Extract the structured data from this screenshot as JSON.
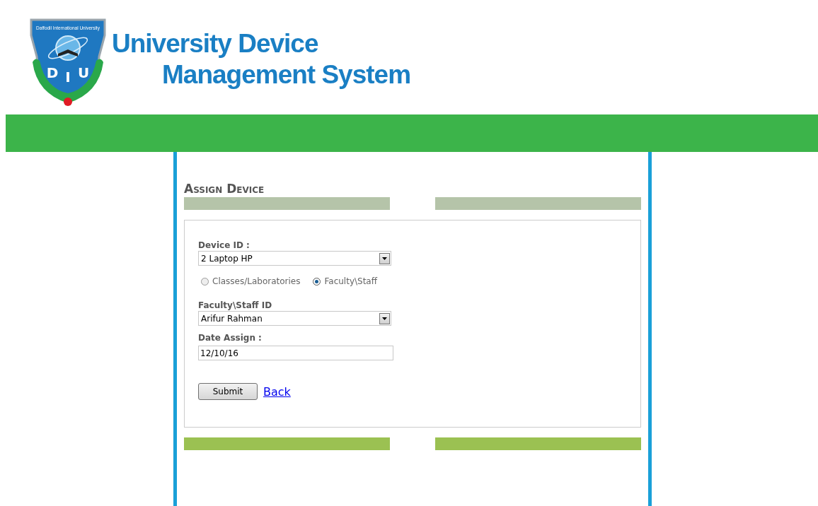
{
  "logo": {
    "caption": "Daffodil International University",
    "letters": [
      "D",
      "I",
      "U"
    ]
  },
  "site_title": {
    "line_1": "University Device",
    "line_2": "Management System"
  },
  "heading": "Assign Device",
  "form": {
    "device_id": {
      "label": "Device ID :",
      "value": "2 Laptop HP"
    },
    "assign_to": [
      {
        "label": "Classes/Laboratories",
        "selected": false
      },
      {
        "label": "Faculty\\Staff",
        "selected": true
      }
    ],
    "staff_id": {
      "label": "Faculty\\Staff ID",
      "value": "Arifur Rahman"
    },
    "date_assign": {
      "label": "Date Assign :",
      "value": "12/10/16"
    },
    "submit": "Submit",
    "back": "Back"
  }
}
